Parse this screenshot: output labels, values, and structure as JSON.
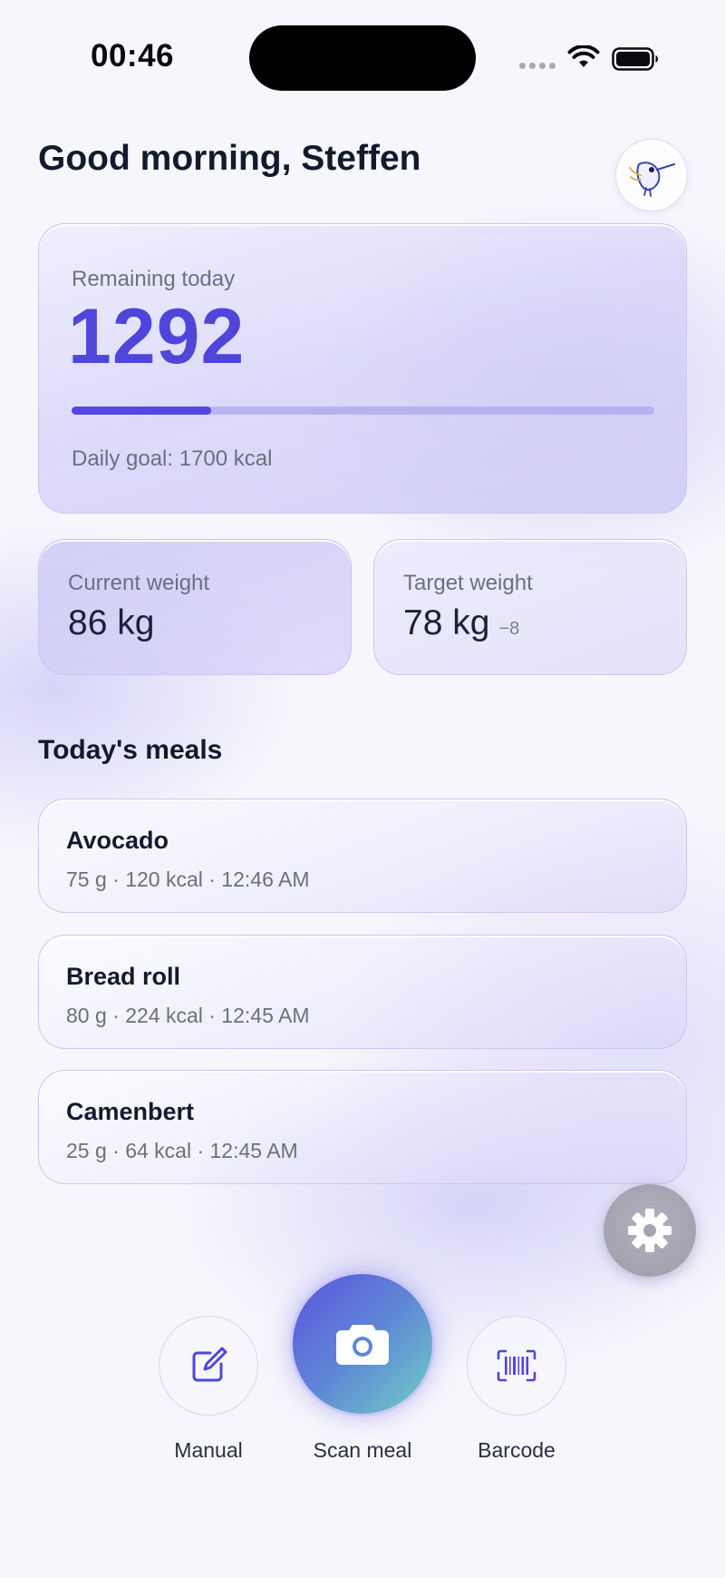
{
  "status_bar": {
    "time": "00:46"
  },
  "header": {
    "greeting": "Good morning, Steffen",
    "avatar_icon": "hummingbird-icon"
  },
  "summary": {
    "remaining_label": "Remaining today",
    "remaining_value": "1292",
    "progress_fraction": 0.24,
    "goal_text": "Daily goal: 1700 kcal",
    "accent_color": "#4f46d9"
  },
  "weights": {
    "current_label": "Current weight",
    "current_value": "86 kg",
    "target_label": "Target weight",
    "target_value": "78 kg",
    "target_delta": "−8"
  },
  "meals": {
    "title": "Today's meals",
    "items": [
      {
        "name": "Avocado",
        "meta": "75 g · 120 kcal · 12:46 AM"
      },
      {
        "name": "Bread roll",
        "meta": "80 g · 224 kcal · 12:45 AM"
      },
      {
        "name": "Camenbert",
        "meta": "25 g · 64 kcal · 12:45 AM"
      }
    ]
  },
  "actions": {
    "settings_icon": "gear-icon",
    "manual_label": "Manual",
    "scan_label": "Scan meal",
    "barcode_label": "Barcode"
  }
}
